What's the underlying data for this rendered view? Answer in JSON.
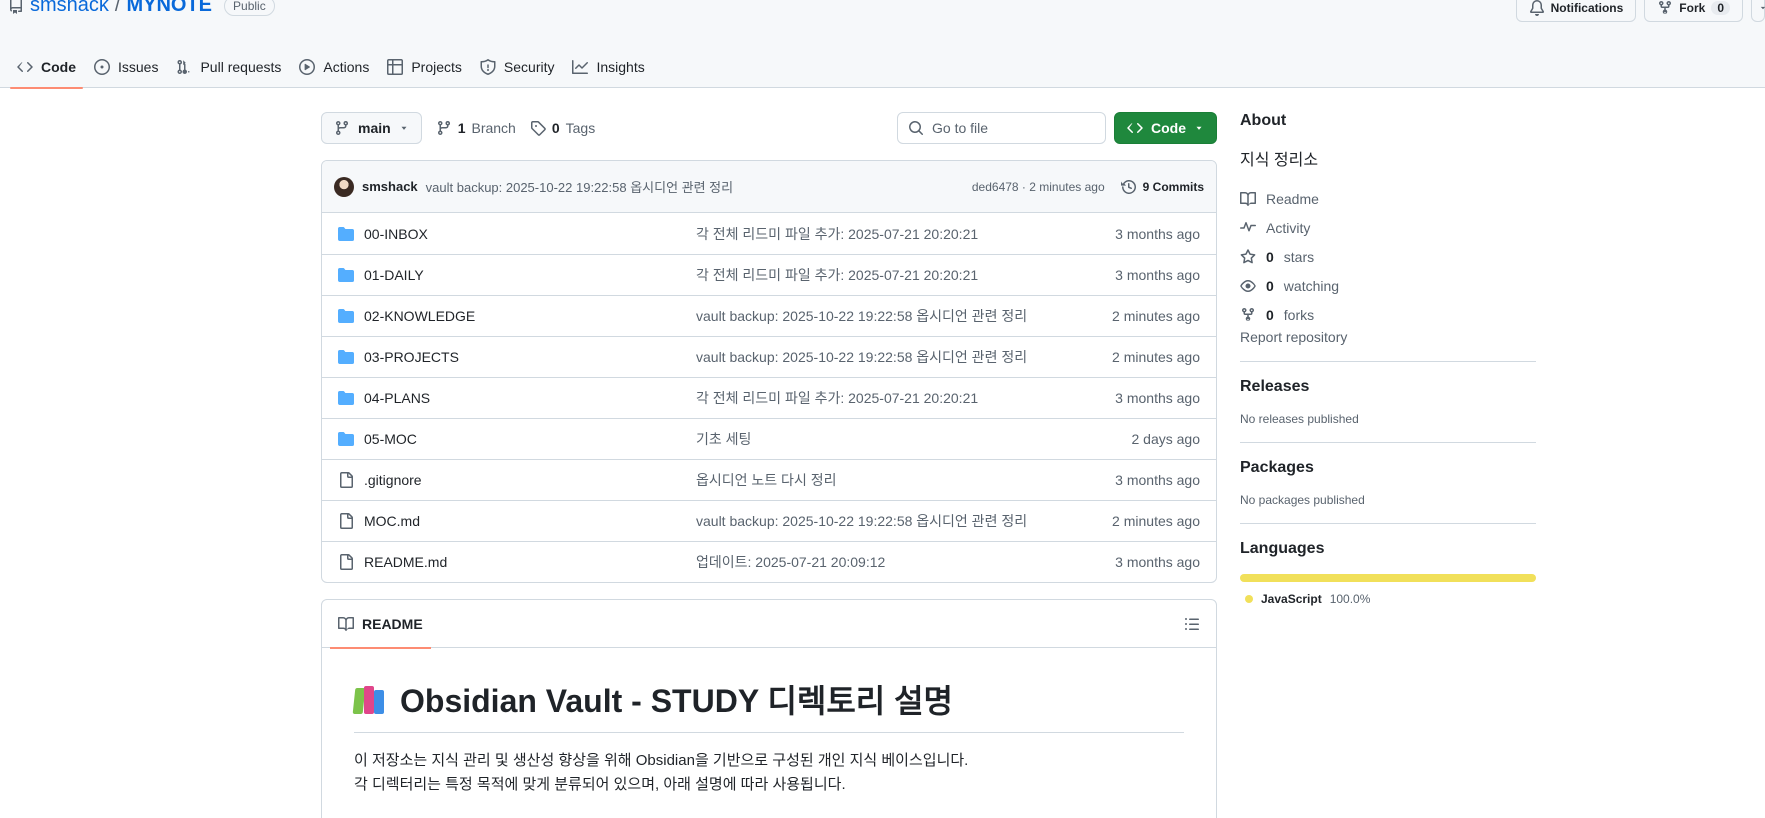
{
  "header": {
    "owner": "smshack",
    "separator": "/",
    "repo": "MYNOTE",
    "visibility": "Public",
    "notifications_label": "Notifications",
    "fork_label": "Fork",
    "fork_count": "0"
  },
  "nav": {
    "tabs": [
      {
        "label": "Code",
        "icon": "code-icon"
      },
      {
        "label": "Issues",
        "icon": "issue-icon"
      },
      {
        "label": "Pull requests",
        "icon": "pull-request-icon"
      },
      {
        "label": "Actions",
        "icon": "play-icon"
      },
      {
        "label": "Projects",
        "icon": "table-icon"
      },
      {
        "label": "Security",
        "icon": "shield-icon"
      },
      {
        "label": "Insights",
        "icon": "graph-icon"
      }
    ]
  },
  "filebar": {
    "branch": "main",
    "branch_count": "1",
    "branch_label": "Branch",
    "tag_count": "0",
    "tag_label": "Tags",
    "goto_placeholder": "Go to file",
    "code_button": "Code"
  },
  "commit": {
    "author": "smshack",
    "message": "vault backup: 2025-10-22 19:22:58 옵시디언 관련 정리",
    "hash_time": "ded6478 · 2 minutes ago",
    "commits_label": "9 Commits"
  },
  "files": [
    {
      "type": "dir",
      "name": "00-INBOX",
      "message": "각 전체 리드미 파일 추가: 2025-07-21 20:20:21",
      "age": "3 months ago"
    },
    {
      "type": "dir",
      "name": "01-DAILY",
      "message": "각 전체 리드미 파일 추가: 2025-07-21 20:20:21",
      "age": "3 months ago"
    },
    {
      "type": "dir",
      "name": "02-KNOWLEDGE",
      "message": "vault backup: 2025-10-22 19:22:58 옵시디언 관련 정리",
      "age": "2 minutes ago"
    },
    {
      "type": "dir",
      "name": "03-PROJECTS",
      "message": "vault backup: 2025-10-22 19:22:58 옵시디언 관련 정리",
      "age": "2 minutes ago"
    },
    {
      "type": "dir",
      "name": "04-PLANS",
      "message": "각 전체 리드미 파일 추가: 2025-07-21 20:20:21",
      "age": "3 months ago"
    },
    {
      "type": "dir",
      "name": "05-MOC",
      "message": "기초 세팅",
      "age": "2 days ago"
    },
    {
      "type": "file",
      "name": ".gitignore",
      "message": "옵시디언 노트 다시 정리",
      "age": "3 months ago"
    },
    {
      "type": "file",
      "name": "MOC.md",
      "message": "vault backup: 2025-10-22 19:22:58 옵시디언 관련 정리",
      "age": "2 minutes ago"
    },
    {
      "type": "file",
      "name": "README.md",
      "message": "업데이트: 2025-07-21 20:09:12",
      "age": "3 months ago"
    }
  ],
  "readme": {
    "tab_label": "README",
    "title": "Obsidian Vault - STUDY 디렉토리 설명",
    "line1": "이 저장소는 지식 관리 및 생산성 향상을 위해 Obsidian을 기반으로 구성된 개인 지식 베이스입니다.",
    "line2": "각 디렉터리는 특정 목적에 맞게 분류되어 있으며, 아래 설명에 따라 사용됩니다."
  },
  "sidebar": {
    "about_title": "About",
    "description": "지식 정리소",
    "readme_label": "Readme",
    "activity_label": "Activity",
    "stars_count": "0",
    "stars_label": "stars",
    "watching_count": "0",
    "watching_label": "watching",
    "forks_count": "0",
    "forks_label": "forks",
    "report_label": "Report repository",
    "releases_title": "Releases",
    "releases_empty": "No releases published",
    "packages_title": "Packages",
    "packages_empty": "No packages published",
    "languages_title": "Languages",
    "language_name": "JavaScript",
    "language_pct": "100.0%",
    "language_color": "#f1e05a"
  },
  "colors": {
    "link": "#0969da",
    "folder": "#54aeff",
    "primary_button": "#1f883d",
    "active_tab_underline": "#fd8c73"
  }
}
